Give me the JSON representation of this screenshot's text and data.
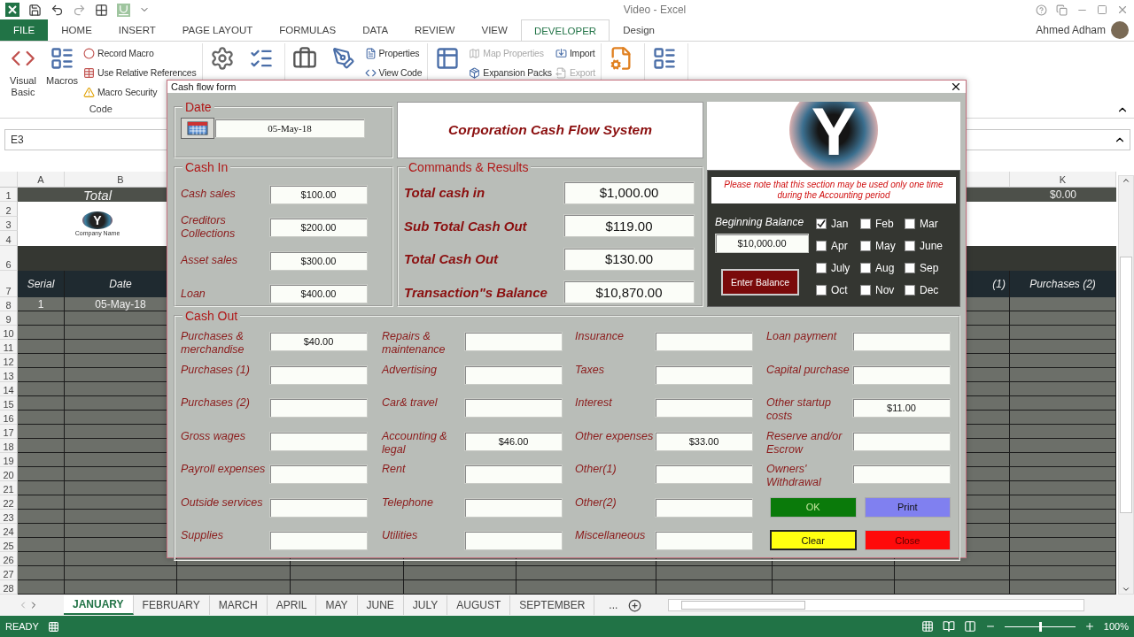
{
  "window": {
    "title": "Video - Excel"
  },
  "ribbon_tabs": [
    {
      "label": "FILE",
      "kind": "file",
      "selected": false
    },
    {
      "label": "HOME",
      "kind": "tab",
      "selected": false
    },
    {
      "label": "INSERT",
      "kind": "tab",
      "selected": false
    },
    {
      "label": "PAGE LAYOUT",
      "kind": "tab",
      "selected": false
    },
    {
      "label": "FORMULAS",
      "kind": "tab",
      "selected": false
    },
    {
      "label": "DATA",
      "kind": "tab",
      "selected": false
    },
    {
      "label": "REVIEW",
      "kind": "tab",
      "selected": false
    },
    {
      "label": "VIEW",
      "kind": "tab",
      "selected": false
    },
    {
      "label": "DEVELOPER",
      "kind": "tab",
      "selected": true
    },
    {
      "label": "Design",
      "kind": "tab",
      "selected": false
    }
  ],
  "user": {
    "name": "Ahmed Adham"
  },
  "ribbon": {
    "code": {
      "label": "Code",
      "large_buttons": [
        "Visual Basic",
        "Macros"
      ],
      "small_buttons": [
        "Record Macro",
        "Use Relative References",
        "Macro Security"
      ]
    },
    "controls": {
      "small_buttons": [
        "Properties",
        "View Code"
      ]
    },
    "xml": {
      "small_buttons": [
        {
          "label": "Map Properties",
          "disabled": true
        },
        {
          "label": "Expansion Packs",
          "disabled": false
        },
        {
          "label": "Import",
          "disabled": false
        },
        {
          "label": "Export",
          "disabled": true
        }
      ]
    }
  },
  "formula_bar": {
    "name_box": "E3"
  },
  "sheet": {
    "column_headers": {
      "A": "A",
      "B": "B",
      "K": "K"
    },
    "logo": {
      "letter": "Y",
      "caption": "Company Name"
    },
    "rows": [
      {
        "number": "1",
        "kind": "total",
        "cells": {
          "A": "Total",
          "K": "$0.00"
        }
      },
      {
        "number": "2",
        "kind": "logo"
      },
      {
        "number": "3",
        "kind": "logo"
      },
      {
        "number": "4",
        "kind": "logo"
      },
      {
        "number": "6",
        "kind": "band"
      },
      {
        "number": "7",
        "kind": "header",
        "cells": {
          "A": "Serial",
          "B": "Date",
          "J": "(1)",
          "K": "Purchases (2)"
        }
      },
      {
        "number": "8",
        "kind": "data",
        "cells": {
          "A": "1",
          "B": "05-May-18"
        }
      },
      {
        "number": "9",
        "kind": "data"
      },
      {
        "number": "10",
        "kind": "data"
      },
      {
        "number": "11",
        "kind": "data"
      },
      {
        "number": "12",
        "kind": "data"
      },
      {
        "number": "13",
        "kind": "data"
      },
      {
        "number": "14",
        "kind": "data"
      },
      {
        "number": "15",
        "kind": "data"
      },
      {
        "number": "16",
        "kind": "data"
      },
      {
        "number": "17",
        "kind": "data"
      },
      {
        "number": "18",
        "kind": "data"
      },
      {
        "number": "19",
        "kind": "data"
      },
      {
        "number": "20",
        "kind": "data"
      },
      {
        "number": "21",
        "kind": "data"
      },
      {
        "number": "22",
        "kind": "data"
      },
      {
        "number": "23",
        "kind": "data"
      },
      {
        "number": "24",
        "kind": "data"
      },
      {
        "number": "25",
        "kind": "data"
      },
      {
        "number": "26",
        "kind": "data"
      },
      {
        "number": "27",
        "kind": "data"
      },
      {
        "number": "28",
        "kind": "data"
      }
    ]
  },
  "sheet_tabs": [
    {
      "label": "JANUARY",
      "selected": true
    },
    {
      "label": "FEBRUARY",
      "selected": false
    },
    {
      "label": "MARCH",
      "selected": false
    },
    {
      "label": "APRIL",
      "selected": false
    },
    {
      "label": "MAY",
      "selected": false
    },
    {
      "label": "JUNE",
      "selected": false
    },
    {
      "label": "JULY",
      "selected": false
    },
    {
      "label": "AUGUST",
      "selected": false
    },
    {
      "label": "SEPTEMBER",
      "selected": false
    }
  ],
  "more_tabs": "...",
  "status_bar": {
    "state": "READY",
    "zoom": {
      "level": 0.5,
      "reading": "100%"
    }
  },
  "dialog": {
    "title": "Cash flow form",
    "date": {
      "title": "Date",
      "value": "05-May-18"
    },
    "banner": "Corporation Cash Flow System",
    "logo_letter": "Y",
    "cash_in": {
      "title": "Cash In",
      "fields": [
        {
          "label": "Cash sales",
          "value": "$100.00"
        },
        {
          "label": "Creditors Collections",
          "value": "$200.00"
        },
        {
          "label": "Asset sales",
          "value": "$300.00"
        },
        {
          "label": "Loan",
          "value": "$400.00"
        }
      ]
    },
    "results": {
      "title": "Commands & Results",
      "fields": [
        {
          "label": "Total cash in",
          "value": "$1,000.00"
        },
        {
          "label": "Sub Total Cash Out",
          "value": "$119.00"
        },
        {
          "label": "Total Cash Out",
          "value": "$130.00"
        },
        {
          "label": "Transaction\"s Balance",
          "value": "$10,870.00"
        }
      ]
    },
    "balance_panel": {
      "note": "Please note that this section may be used only one time during the Accounting period",
      "label": "Beginning Balance",
      "value": "$10,000.00",
      "button": "Enter Balance",
      "months": [
        {
          "label": "Jan",
          "checked": true
        },
        {
          "label": "Feb",
          "checked": false
        },
        {
          "label": "Mar",
          "checked": false
        },
        {
          "label": "Apr",
          "checked": false
        },
        {
          "label": "May",
          "checked": false
        },
        {
          "label": "June",
          "checked": false
        },
        {
          "label": "July",
          "checked": false
        },
        {
          "label": "Aug",
          "checked": false
        },
        {
          "label": "Sep",
          "checked": false
        },
        {
          "label": "Oct",
          "checked": false
        },
        {
          "label": "Nov",
          "checked": false
        },
        {
          "label": "Dec",
          "checked": false
        }
      ]
    },
    "cash_out": {
      "title": "Cash Out",
      "columns": [
        [
          {
            "label": "Purchases & merchandise",
            "value": "$40.00"
          },
          {
            "label": "Purchases (1)"
          },
          {
            "label": "Purchases (2)"
          },
          {
            "label": "Gross wages"
          },
          {
            "label": "Payroll expenses"
          },
          {
            "label": "Outside services"
          },
          {
            "label": "Supplies"
          }
        ],
        [
          {
            "label": "Repairs & maintenance"
          },
          {
            "label": "Advertising"
          },
          {
            "label": "Car& travel"
          },
          {
            "label": "Accounting & legal",
            "value": "$46.00"
          },
          {
            "label": "Rent"
          },
          {
            "label": "Telephone"
          },
          {
            "label": "Utilities"
          }
        ],
        [
          {
            "label": "Insurance"
          },
          {
            "label": "Taxes"
          },
          {
            "label": "Interest"
          },
          {
            "label": "Other expenses",
            "value": "$33.00"
          },
          {
            "label": "Other(1)"
          },
          {
            "label": "Other(2)"
          },
          {
            "label": "Miscellaneous"
          }
        ],
        [
          {
            "label": "Loan payment"
          },
          {
            "label": "Capital purchase"
          },
          {
            "label": "Other startup costs",
            "value": "$11.00"
          },
          {
            "label": "Reserve and/or Escrow"
          },
          {
            "label": "Owners' Withdrawal"
          }
        ]
      ],
      "buttons": [
        {
          "label": "OK",
          "kind": "ok"
        },
        {
          "label": "Print",
          "kind": "print"
        },
        {
          "label": "Clear",
          "kind": "clear"
        },
        {
          "label": "Close",
          "kind": "close"
        }
      ]
    }
  }
}
